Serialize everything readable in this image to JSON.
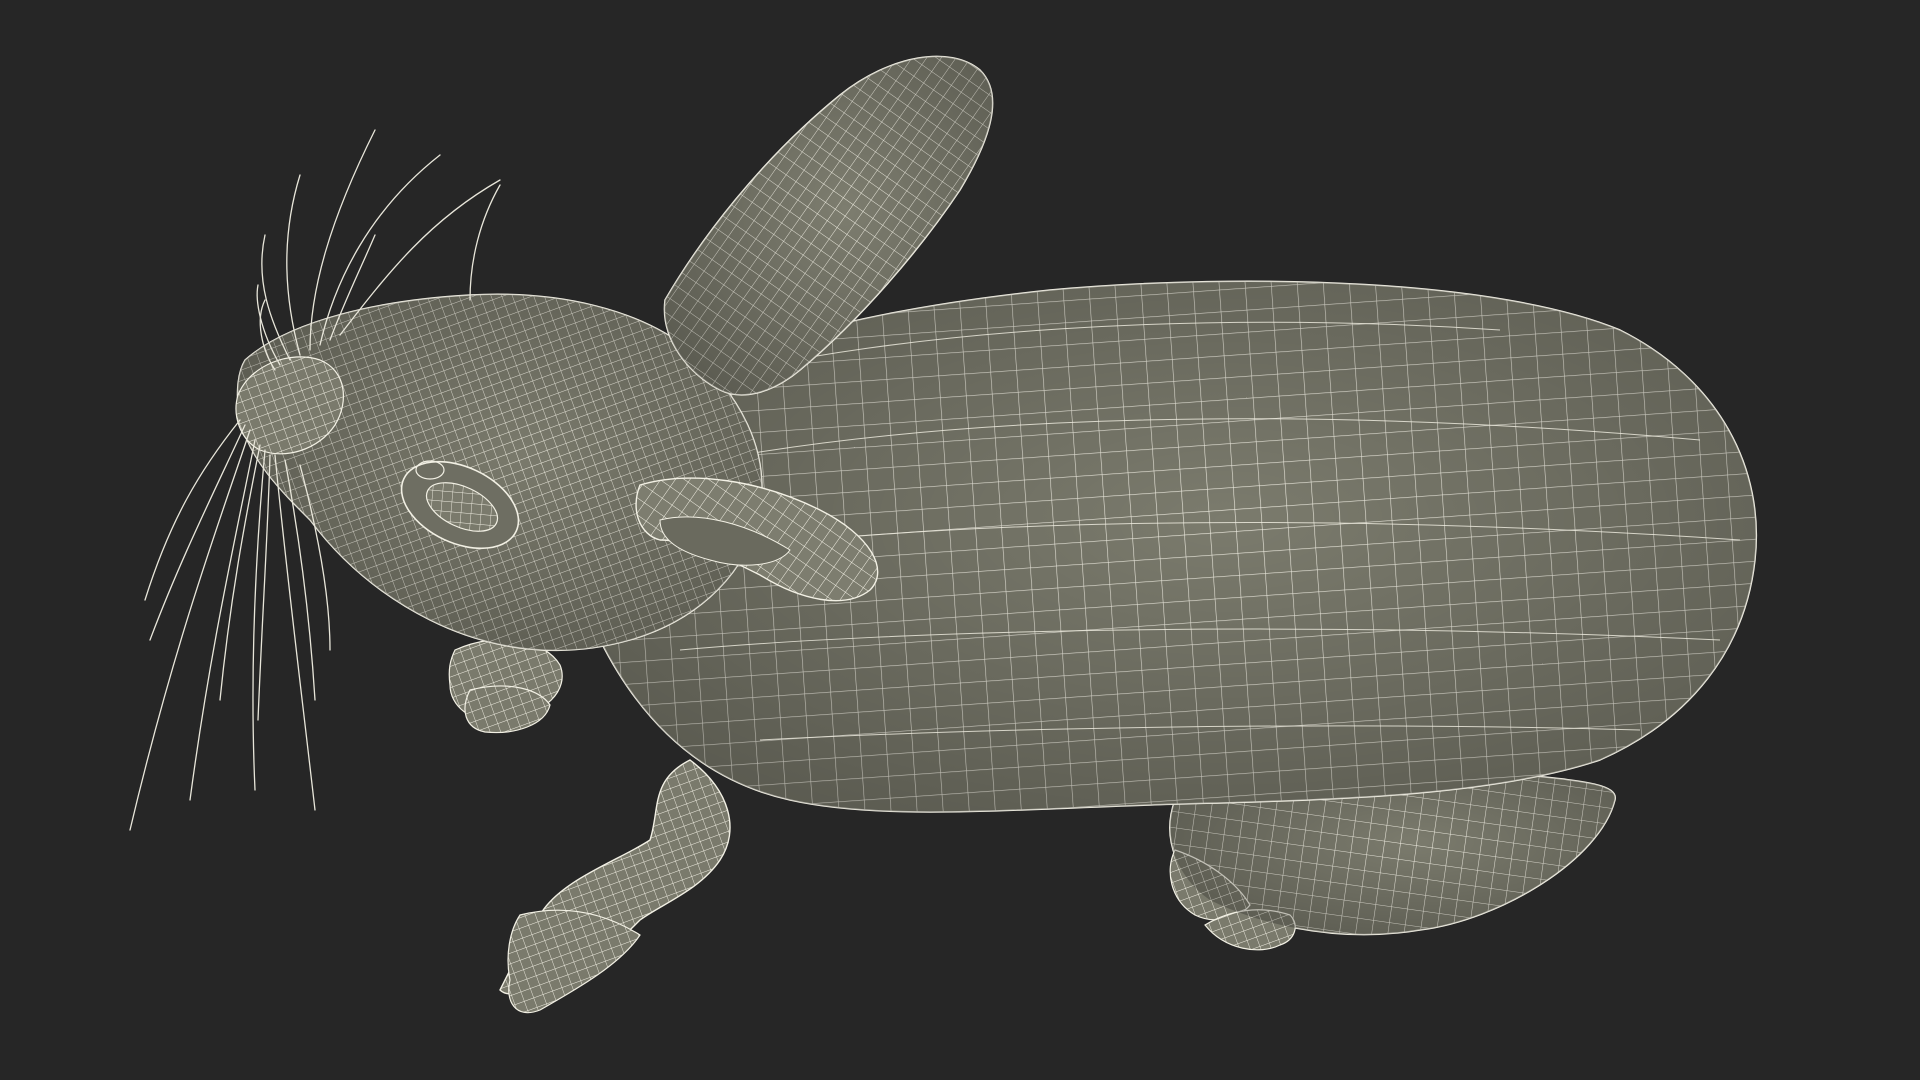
{
  "scene": {
    "subject": "rabbit-wireframe-model",
    "render_style": "wireframe",
    "colors": {
      "background": "#262626",
      "mesh_fill": "#7b7b6d",
      "mesh_fill_light": "#8a8a7c",
      "mesh_shadow": "#5e5e53",
      "wire": "#f2f0e4",
      "whisker": "#e8e6da"
    },
    "icons": {
      "model": "rabbit-icon"
    }
  }
}
